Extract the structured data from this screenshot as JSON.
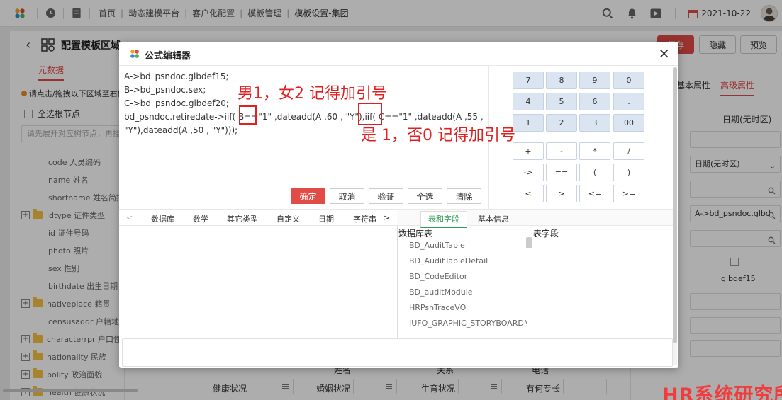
{
  "topnav": {
    "breadcrumbs": [
      "首页",
      "动态建模平台",
      "客户化配置",
      "模板管理",
      "模板设置-集团"
    ],
    "date": "2021-10-22"
  },
  "page": {
    "title": "配置模板区域",
    "buttons": [
      "保存",
      "隐藏",
      "预览"
    ],
    "left_tab": "元数据",
    "tip": "请点击/拖拽以下区域至右侧",
    "select_all": "全选根节点",
    "search_placeholder": "请先展开对应树节点，再搜索",
    "tree": [
      {
        "label": "code 人员编码",
        "folder": false
      },
      {
        "label": "name 姓名",
        "folder": false
      },
      {
        "label": "shortname 姓名简拼",
        "folder": false
      },
      {
        "label": "idtype 证件类型",
        "folder": true
      },
      {
        "label": "id 证件号码",
        "folder": false
      },
      {
        "label": "photo 照片",
        "folder": false
      },
      {
        "label": "sex 性别",
        "folder": false
      },
      {
        "label": "birthdate 出生日期",
        "folder": false
      },
      {
        "label": "nativeplace 籍贯",
        "folder": true
      },
      {
        "label": "censusaddr 户籍地址",
        "folder": false
      },
      {
        "label": "characterrpr 户口性质",
        "folder": true
      },
      {
        "label": "nationality 民族",
        "folder": true
      },
      {
        "label": "polity 政治面貌",
        "folder": true
      },
      {
        "label": "health 健康状况",
        "folder": true
      }
    ],
    "right_tabs": [
      "基本属性",
      "高级属性"
    ],
    "right_fields": {
      "date_type": "日期(无时区)",
      "date_select": "日期(无时区)",
      "formula": "A->bd_psndoc.glbd",
      "code": "glbdef15"
    },
    "bottom_form": [
      "健康状况",
      "婚姻状况",
      "生育状况",
      "有何专长",
      "姓名",
      "关系",
      "电话"
    ]
  },
  "dialog": {
    "title": "公式编辑器",
    "code_lines": [
      "A->bd_psndoc.glbdef15;",
      "B->bd_psndoc.sex;",
      "C->bd_psndoc.glbdef20;",
      "bd_psndoc.retiredate->iif( B==\"1\" ,dateadd(A ,60 , \"Y\"),iif( C==\"1\" ,dateadd(A ,55 ,",
      "\"Y\"),dateadd(A ,50 , \"Y\")));"
    ],
    "editor_buttons": [
      "确定",
      "取消",
      "验证",
      "全选",
      "清除"
    ],
    "keypad": [
      [
        "7",
        "8",
        "9",
        "0"
      ],
      [
        "4",
        "5",
        "6",
        "."
      ],
      [
        "1",
        "2",
        "3",
        "00"
      ],
      [
        "+",
        "-",
        "*",
        "/"
      ],
      [
        "->",
        "==",
        "(",
        ")"
      ],
      [
        "<",
        ">",
        "<=",
        ">="
      ]
    ],
    "func_tabs": [
      "<",
      "数据库",
      "数学",
      "其它类型",
      "自定义",
      "日期",
      "字符串",
      ">"
    ],
    "table_tabs": [
      "表和字段",
      "基本信息"
    ],
    "db_table_header": "数据库表",
    "field_header": "表字段",
    "db_tables": [
      "BD_AuditTable",
      "BD_AuditTableDetail",
      "BD_CodeEditor",
      "BD_auditModule",
      "HRPsnTraceVO",
      "IUFO_GRAPHIC_STORYBOARDMODEL"
    ]
  },
  "annotations": {
    "top": "男1，女2 记得加引号",
    "bottom": "是 1，否0 记得加引号"
  },
  "watermark": "HR系统研究所",
  "colors": {
    "accent_red": "#e14c46",
    "annotation_red": "#e02020",
    "key_blue": "#dbe5f2",
    "tab_green": "#2e9d58"
  }
}
